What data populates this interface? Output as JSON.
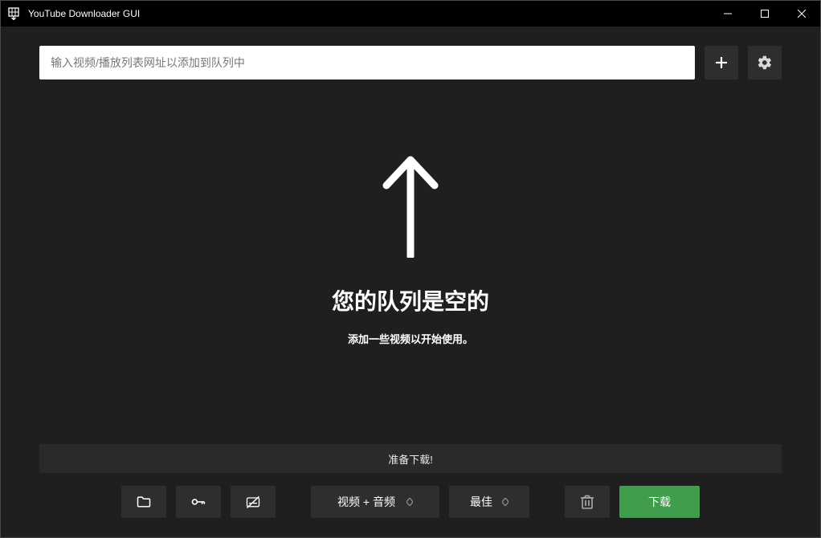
{
  "window": {
    "title": "YouTube Downloader GUI"
  },
  "toolbar": {
    "url_placeholder": "输入视频/播放列表网址以添加到队列中"
  },
  "empty": {
    "title": "您的队列是空的",
    "subtitle": "添加一些视频以开始使用。"
  },
  "status": {
    "text": "准备下载!"
  },
  "controls": {
    "format_label": "视频 + 音频",
    "quality_label": "最佳",
    "download_label": "下载"
  }
}
